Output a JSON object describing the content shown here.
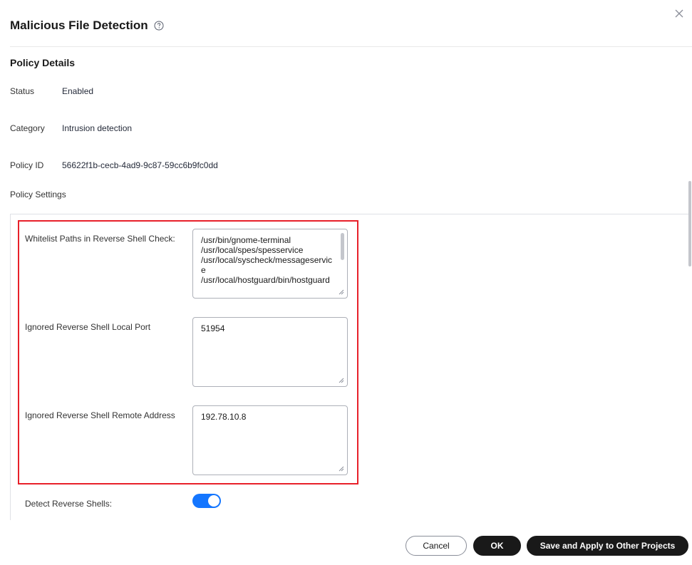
{
  "dialog": {
    "title": "Malicious File Detection",
    "help_icon": "question-circle-icon",
    "close_icon": "close-icon"
  },
  "policy_details": {
    "section_title": "Policy Details",
    "status_label": "Status",
    "status_value": "Enabled",
    "category_label": "Category",
    "category_value": "Intrusion detection",
    "policy_id_label": "Policy ID",
    "policy_id_value": "56622f1b-cecb-4ad9-9c87-59cc6b9fc0dd"
  },
  "policy_settings": {
    "label": "Policy Settings",
    "whitelist_label": "Whitelist Paths in Reverse Shell Check:",
    "whitelist_value": "/usr/bin/gnome-terminal\n/usr/local/spes/spesservice\n/usr/local/syscheck/messageservice\n/usr/local/hostguard/bin/hostguard",
    "local_port_label": "Ignored Reverse Shell Local Port",
    "local_port_value": "51954",
    "remote_address_label": "Ignored Reverse Shell Remote Address",
    "remote_address_value": "192.78.10.8",
    "detect_label": "Detect Reverse Shells:",
    "detect_enabled": true
  },
  "footer": {
    "cancel_label": "Cancel",
    "ok_label": "OK",
    "save_apply_label": "Save and Apply to Other Projects"
  },
  "colors": {
    "accent": "#1476ff",
    "primary_button": "#191919",
    "highlight_border": "#e8202a"
  }
}
